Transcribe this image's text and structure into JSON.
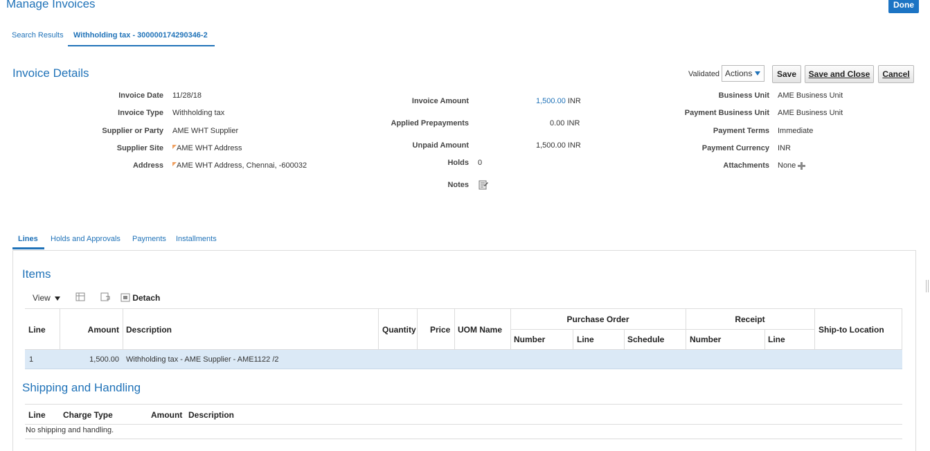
{
  "page": {
    "title": "Manage Invoices",
    "done_label": "Done"
  },
  "top_tabs": [
    {
      "label": "Search Results",
      "active": false
    },
    {
      "label": "Withholding tax - 300000174290346-2",
      "active": true
    }
  ],
  "header": {
    "title": "Invoice Details",
    "status": "Validated",
    "actions_label": "Actions",
    "save_label": "Save",
    "save_close_label": "Save and Close",
    "cancel_label": "Cancel"
  },
  "left_fields": [
    {
      "label": "Invoice Date",
      "value": "11/28/18"
    },
    {
      "label": "Invoice Type",
      "value": "Withholding tax"
    },
    {
      "label": "Supplier or Party",
      "value": "AME WHT Supplier"
    },
    {
      "label": "Supplier Site",
      "value": "AME WHT Address"
    },
    {
      "label": "Address",
      "value": "AME WHT Address, Chennai, -600032"
    }
  ],
  "mid_fields": {
    "invoice_amount": {
      "label": "Invoice Amount",
      "value": "1,500.00",
      "currency": "INR"
    },
    "applied_prepayments": {
      "label": "Applied Prepayments",
      "value": "0.00",
      "currency": "INR"
    },
    "unpaid_amount": {
      "label": "Unpaid Amount",
      "value": "1,500.00",
      "currency": "INR"
    },
    "holds": {
      "label": "Holds",
      "value": "0"
    },
    "notes": {
      "label": "Notes"
    }
  },
  "right_fields": [
    {
      "label": "Business Unit",
      "value": "AME Business Unit"
    },
    {
      "label": "Payment Business Unit",
      "value": "AME Business Unit"
    },
    {
      "label": "Payment Terms",
      "value": "Immediate"
    },
    {
      "label": "Payment Currency",
      "value": "INR"
    },
    {
      "label": "Attachments",
      "value": "None"
    }
  ],
  "sub_tabs": [
    {
      "label": "Lines",
      "active": true
    },
    {
      "label": "Holds and Approvals",
      "active": false
    },
    {
      "label": "Payments",
      "active": false
    },
    {
      "label": "Installments",
      "active": false
    }
  ],
  "items": {
    "title": "Items",
    "toolbar": {
      "view_label": "View",
      "detach_label": "Detach"
    },
    "columns": {
      "line": "Line",
      "amount": "Amount",
      "description": "Description",
      "quantity": "Quantity",
      "price": "Price",
      "uom": "UOM Name",
      "po_group": "Purchase Order",
      "po_number": "Number",
      "po_line": "Line",
      "po_schedule": "Schedule",
      "receipt_group": "Receipt",
      "receipt_number": "Number",
      "receipt_line": "Line",
      "ship_to": "Ship-to Location"
    },
    "rows": [
      {
        "line": "1",
        "amount": "1,500.00",
        "description": "Withholding tax - AME Supplier - AME1122 /2"
      }
    ]
  },
  "shipping": {
    "title": "Shipping and Handling",
    "columns": {
      "line": "Line",
      "charge_type": "Charge Type",
      "amount": "Amount",
      "description": "Description"
    },
    "empty_text": "No shipping and handling."
  },
  "colors": {
    "accent": "#1f72b8",
    "selected_row": "#dbe9f6",
    "done_button": "#1c74c4"
  }
}
